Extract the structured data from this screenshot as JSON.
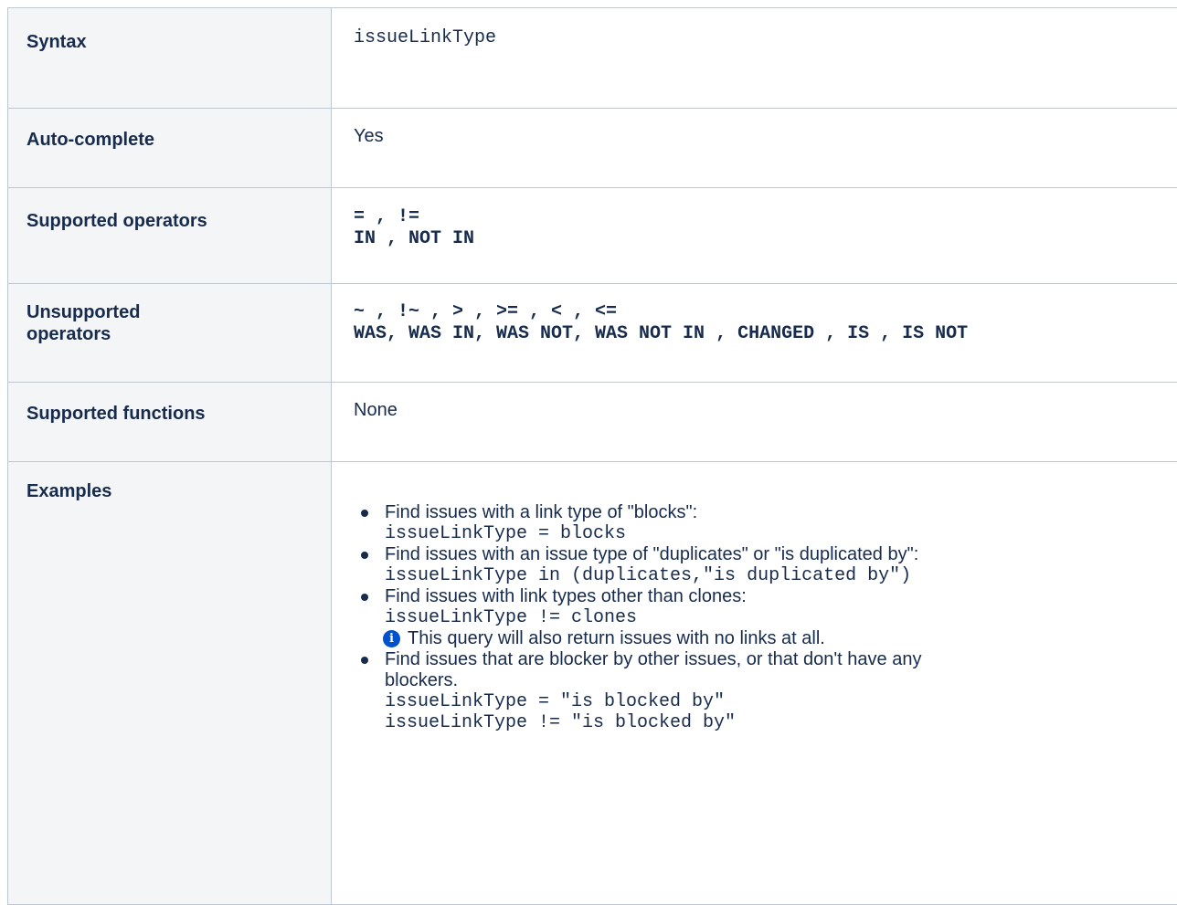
{
  "rows": {
    "syntax": {
      "label": "Syntax",
      "value": "issueLinkType"
    },
    "autocomplete": {
      "label": "Auto-complete",
      "value": "Yes"
    },
    "supported_operators": {
      "label": "Supported operators",
      "line1": "= , !=",
      "line2": "IN , NOT IN"
    },
    "unsupported_operators": {
      "label_line1": "Unsupported",
      "label_line2": "operators",
      "line1": "~ , !~ , > , >= , < , <=",
      "line2": "WAS, WAS IN, WAS NOT, WAS NOT IN , CHANGED , IS , IS NOT"
    },
    "supported_functions": {
      "label": "Supported functions",
      "value": "None"
    },
    "examples": {
      "label": "Examples",
      "items": [
        {
          "text": "Find issues with a link type of \"blocks\":",
          "code": [
            "issueLinkType = blocks"
          ]
        },
        {
          "text": "Find issues with an issue type of \"duplicates\" or \"is duplicated by\":",
          "code": [
            "issueLinkType in (duplicates,\"is duplicated by\")"
          ]
        },
        {
          "text": "Find issues with link types other than clones:",
          "code": [
            "issueLinkType != clones"
          ],
          "note": "This query will also return issues with no links at all.",
          "note_icon": "info-icon"
        },
        {
          "text_line1": "Find issues that are blocker by other issues, or that don't have any",
          "text_line2": "blockers.",
          "code": [
            "issueLinkType = \"is blocked by\"",
            "issueLinkType != \"is blocked by\""
          ]
        }
      ]
    }
  },
  "colors": {
    "label_bg": "#f4f5f7",
    "border": "#c1c7d0",
    "text": "#172b4d",
    "info_icon": "#0052cc"
  }
}
